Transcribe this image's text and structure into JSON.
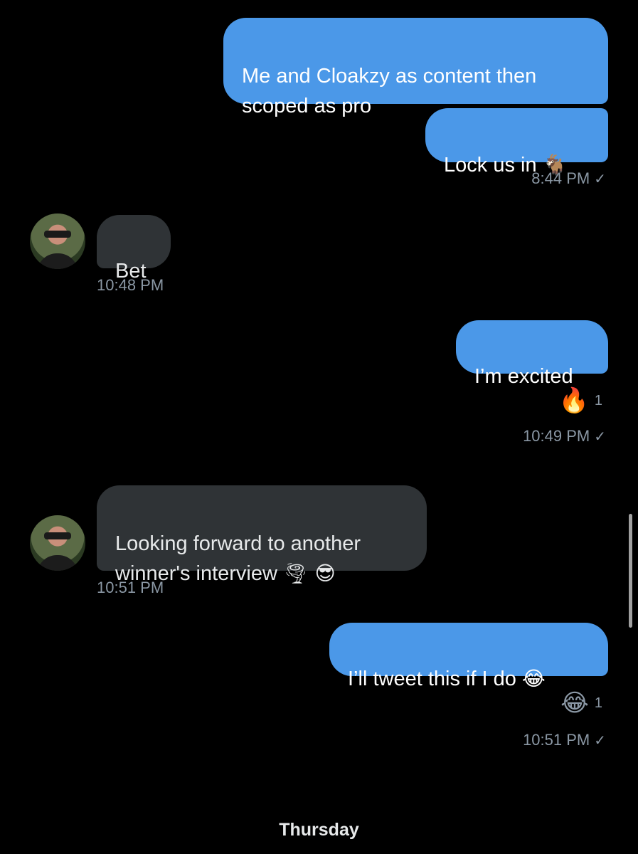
{
  "messages": [
    {
      "text": "Me and Cloakzy as content then\nscoped as pro"
    },
    {
      "text": "Lock us in ",
      "emoji": "🐐"
    },
    {
      "time": "8:44 PM"
    },
    {
      "text": "Bet",
      "time": "10:48 PM"
    },
    {
      "text": "I’m excited",
      "reaction_emoji": "🔥",
      "reaction_count": "1",
      "time": "10:49 PM"
    },
    {
      "text": "Looking forward to another\nwinner's interview ",
      "emoji": "🌪 😎",
      "time": "10:51 PM"
    },
    {
      "text": "I’ll tweet this if I do ",
      "emoji": "😂",
      "reaction_emoji": "😂",
      "reaction_count": "1",
      "time": "10:51 PM"
    }
  ],
  "read_receipt": "✓",
  "day_separator": "Thursday",
  "colors": {
    "background": "#000000",
    "outgoing_bubble": "#4b98e8",
    "incoming_bubble": "#2f3336",
    "timestamp": "#8b98a5"
  }
}
